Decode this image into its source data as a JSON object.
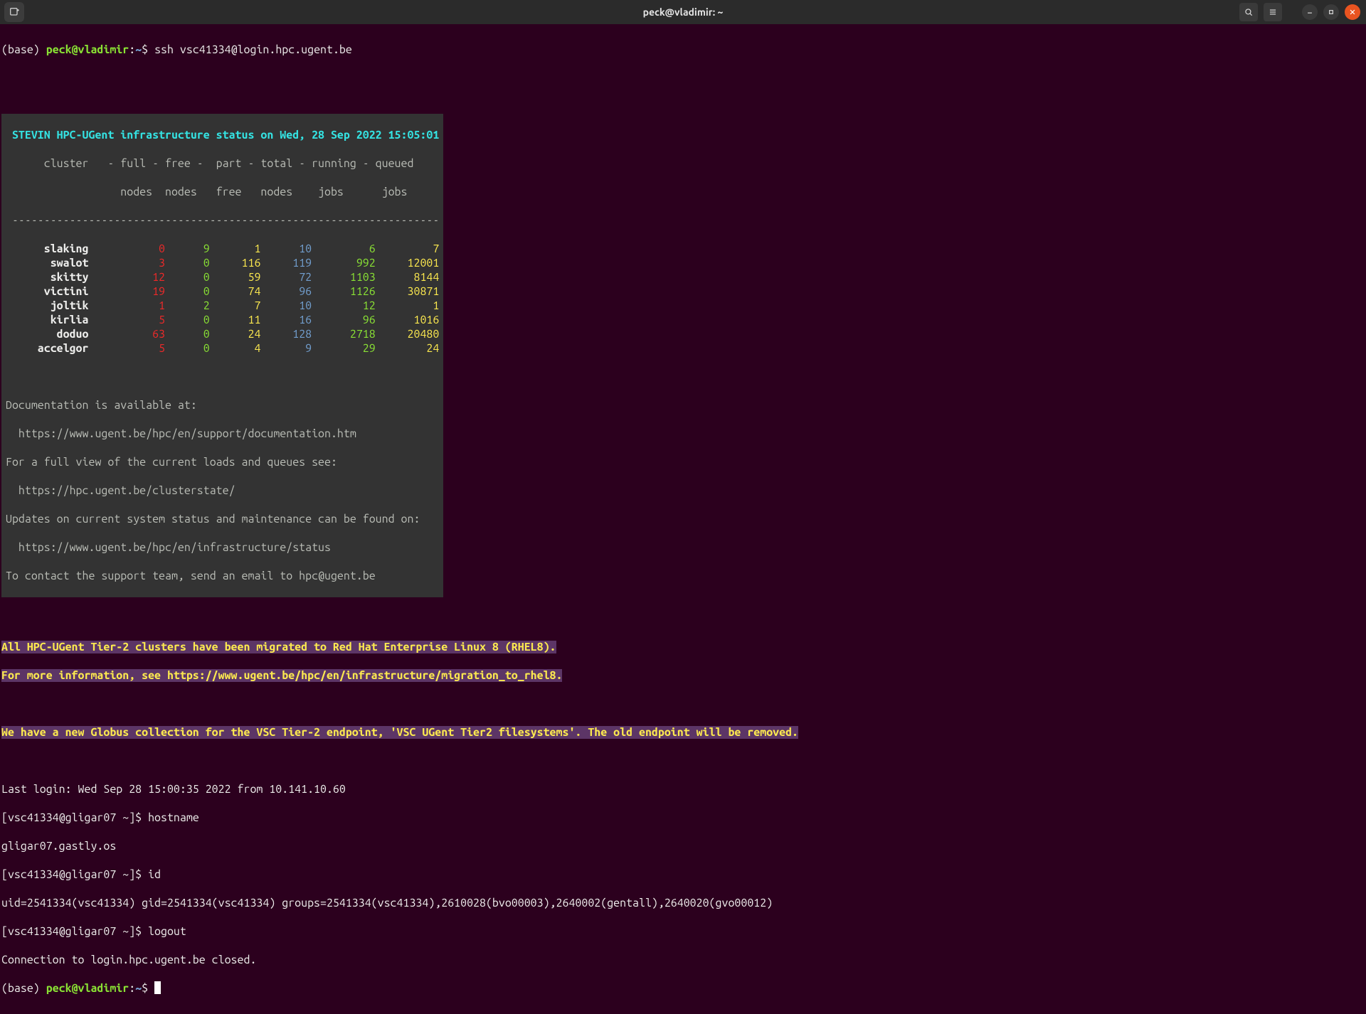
{
  "window": {
    "title": "peck@vladimir: ~"
  },
  "prompt1": {
    "base": "(base) ",
    "userhost": "peck@vladimir",
    "colon": ":",
    "cwd": "~",
    "dollar": "$ ",
    "cmd": "ssh vsc41334@login.hpc.ugent.be"
  },
  "motd": {
    "header": " STEVIN HPC-UGent infrastructure status on Wed, 28 Sep 2022 15:05:01",
    "cols1": "      cluster   - full - free -  part - total - running - queued",
    "cols2": "                  nodes  nodes   free   nodes    jobs      jobs ",
    "sep": " -------------------------------------------------------------------",
    "rows": [
      {
        "name": "slaking",
        "full": "0",
        "free": "9",
        "part": "1",
        "total": "10",
        "run": "6",
        "queued": "7"
      },
      {
        "name": "swalot",
        "full": "3",
        "free": "0",
        "part": "116",
        "total": "119",
        "run": "992",
        "queued": "12001"
      },
      {
        "name": "skitty",
        "full": "12",
        "free": "0",
        "part": "59",
        "total": "72",
        "run": "1103",
        "queued": "8144"
      },
      {
        "name": "victini",
        "full": "19",
        "free": "0",
        "part": "74",
        "total": "96",
        "run": "1126",
        "queued": "30871"
      },
      {
        "name": "joltik",
        "full": "1",
        "free": "2",
        "part": "7",
        "total": "10",
        "run": "12",
        "queued": "1"
      },
      {
        "name": "kirlia",
        "full": "5",
        "free": "0",
        "part": "11",
        "total": "16",
        "run": "96",
        "queued": "1016"
      },
      {
        "name": "doduo",
        "full": "63",
        "free": "0",
        "part": "24",
        "total": "128",
        "run": "2718",
        "queued": "20480"
      },
      {
        "name": "accelgor",
        "full": "5",
        "free": "0",
        "part": "4",
        "total": "9",
        "run": "29",
        "queued": "24"
      }
    ],
    "doc1": "Documentation is available at:",
    "doc2": "  https://www.ugent.be/hpc/en/support/documentation.htm",
    "doc3": "For a full view of the current loads and queues see:",
    "doc4": "  https://hpc.ugent.be/clusterstate/",
    "doc5": "Updates on current system status and maintenance can be found on:",
    "doc6": "  https://www.ugent.be/hpc/en/infrastructure/status",
    "doc7": "To contact the support team, send an email to hpc@ugent.be"
  },
  "notice1a": "All HPC-UGent Tier-2 clusters have been migrated to Red Hat Enterprise Linux 8 (RHEL8).",
  "notice1b": "For more information, see https://www.ugent.be/hpc/en/infrastructure/migration_to_rhel8.",
  "notice2": "We have a new Globus collection for the VSC Tier-2 endpoint, 'VSC UGent Tier2 filesystems'. The old endpoint will be removed.",
  "session": {
    "lastlogin": "Last login: Wed Sep 28 15:00:35 2022 from 10.141.10.60",
    "p1": "[vsc41334@gligar07 ~]$ ",
    "cmd1": "hostname",
    "out1": "gligar07.gastly.os",
    "p2": "[vsc41334@gligar07 ~]$ ",
    "cmd2": "id",
    "out2": "uid=2541334(vsc41334) gid=2541334(vsc41334) groups=2541334(vsc41334),2610028(bvo00003),2640002(gentall),2640020(gvo00012)",
    "p3": "[vsc41334@gligar07 ~]$ ",
    "cmd3": "logout",
    "closed": "Connection to login.hpc.ugent.be closed."
  },
  "prompt2": {
    "base": "(base) ",
    "userhost": "peck@vladimir",
    "colon": ":",
    "cwd": "~",
    "dollar": "$ "
  }
}
